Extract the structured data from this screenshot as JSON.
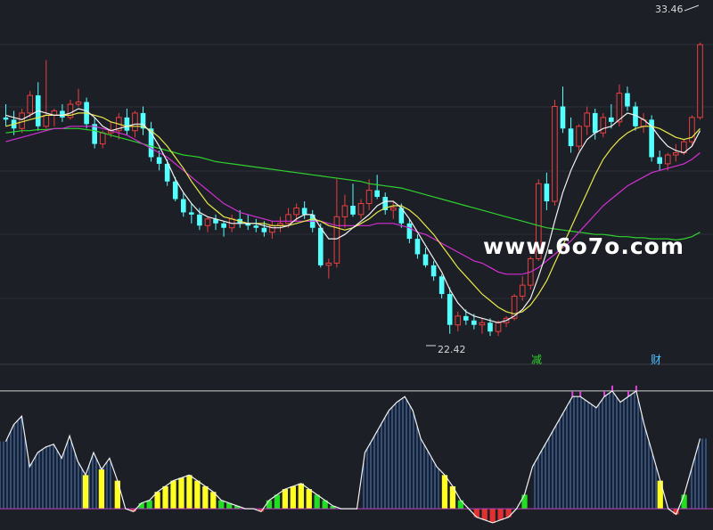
{
  "chart_data": [
    {
      "type": "candlestick",
      "panel": "main",
      "price_range": [
        19.5,
        35.0
      ],
      "annotations": {
        "high_label": "33.46",
        "low_label": "22.42",
        "event_markers": [
          "减",
          "财"
        ],
        "watermark": "www.6o7o.com"
      },
      "candles": [
        [
          30.0,
          30.6,
          29.6,
          29.9
        ],
        [
          29.9,
          30.3,
          29.2,
          29.5
        ],
        [
          29.5,
          30.4,
          29.3,
          30.2
        ],
        [
          30.2,
          31.2,
          30.0,
          31.0
        ],
        [
          31.0,
          31.6,
          29.4,
          29.6
        ],
        [
          29.6,
          32.6,
          29.5,
          30.1
        ],
        [
          30.1,
          30.4,
          29.6,
          30.3
        ],
        [
          30.3,
          30.6,
          29.8,
          30.0
        ],
        [
          30.0,
          30.8,
          29.9,
          30.6
        ],
        [
          30.6,
          31.3,
          30.5,
          30.7
        ],
        [
          30.7,
          30.9,
          29.5,
          29.7
        ],
        [
          29.7,
          30.0,
          28.6,
          28.8
        ],
        [
          28.8,
          29.4,
          28.6,
          29.3
        ],
        [
          29.3,
          29.8,
          29.1,
          29.4
        ],
        [
          29.4,
          30.2,
          29.0,
          30.0
        ],
        [
          30.0,
          30.4,
          29.2,
          29.4
        ],
        [
          29.4,
          30.3,
          29.1,
          30.2
        ],
        [
          30.2,
          30.5,
          29.2,
          29.5
        ],
        [
          29.5,
          29.8,
          28.0,
          28.2
        ],
        [
          28.2,
          28.5,
          27.6,
          27.9
        ],
        [
          27.9,
          28.1,
          26.9,
          27.1
        ],
        [
          27.1,
          27.3,
          26.2,
          26.3
        ],
        [
          26.3,
          26.6,
          25.5,
          25.7
        ],
        [
          25.7,
          26.1,
          25.2,
          25.6
        ],
        [
          25.6,
          25.9,
          24.9,
          25.1
        ],
        [
          25.1,
          25.5,
          24.8,
          25.4
        ],
        [
          25.4,
          25.6,
          24.9,
          25.2
        ],
        [
          25.2,
          25.3,
          24.6,
          25.0
        ],
        [
          25.0,
          25.6,
          24.8,
          25.4
        ],
        [
          25.4,
          25.8,
          25.0,
          25.2
        ],
        [
          25.2,
          25.6,
          24.9,
          25.1
        ],
        [
          25.1,
          25.4,
          24.8,
          25.0
        ],
        [
          25.0,
          25.3,
          24.6,
          24.8
        ],
        [
          24.8,
          25.3,
          24.5,
          25.1
        ],
        [
          25.1,
          25.5,
          24.8,
          25.2
        ],
        [
          25.2,
          25.9,
          25.0,
          25.6
        ],
        [
          25.6,
          26.1,
          25.3,
          25.9
        ],
        [
          25.9,
          26.2,
          25.4,
          25.6
        ],
        [
          25.6,
          25.8,
          24.8,
          25.0
        ],
        [
          25.0,
          25.2,
          23.2,
          23.3
        ],
        [
          23.3,
          23.6,
          22.7,
          23.4
        ],
        [
          23.4,
          27.2,
          23.2,
          25.5
        ],
        [
          25.5,
          26.5,
          25.0,
          26.0
        ],
        [
          26.0,
          27.0,
          25.5,
          25.6
        ],
        [
          25.6,
          26.3,
          25.4,
          26.1
        ],
        [
          26.1,
          27.2,
          25.8,
          26.7
        ],
        [
          26.7,
          27.4,
          26.3,
          26.4
        ],
        [
          26.4,
          26.6,
          25.6,
          25.8
        ],
        [
          25.8,
          26.2,
          25.4,
          25.9
        ],
        [
          25.9,
          26.1,
          25.0,
          25.2
        ],
        [
          25.2,
          25.4,
          24.3,
          24.5
        ],
        [
          24.5,
          24.7,
          23.6,
          23.8
        ],
        [
          23.8,
          24.1,
          23.2,
          23.3
        ],
        [
          23.3,
          23.5,
          22.6,
          22.8
        ],
        [
          22.8,
          22.9,
          21.8,
          22.0
        ],
        [
          22.0,
          22.3,
          20.2,
          20.6
        ],
        [
          20.6,
          21.2,
          20.3,
          21.0
        ],
        [
          21.0,
          21.3,
          20.6,
          20.8
        ],
        [
          20.8,
          21.1,
          20.4,
          20.6
        ],
        [
          20.6,
          20.9,
          20.2,
          20.7
        ],
        [
          20.7,
          20.9,
          20.1,
          20.3
        ],
        [
          20.3,
          20.8,
          20.1,
          20.7
        ],
        [
          20.7,
          21.0,
          20.5,
          20.9
        ],
        [
          20.9,
          22.0,
          20.8,
          21.9
        ],
        [
          21.9,
          22.8,
          21.7,
          22.4
        ],
        [
          22.4,
          23.7,
          22.2,
          23.6
        ],
        [
          23.6,
          27.2,
          23.5,
          27.0
        ],
        [
          27.0,
          27.5,
          25.8,
          26.2
        ],
        [
          26.2,
          30.8,
          26.0,
          30.5
        ],
        [
          30.5,
          31.4,
          29.3,
          29.5
        ],
        [
          29.5,
          30.0,
          28.4,
          28.7
        ],
        [
          28.7,
          29.7,
          28.5,
          29.6
        ],
        [
          29.6,
          30.5,
          29.2,
          30.2
        ],
        [
          30.2,
          30.4,
          29.0,
          29.3
        ],
        [
          29.3,
          30.2,
          29.1,
          30.0
        ],
        [
          30.0,
          30.6,
          29.5,
          29.8
        ],
        [
          29.8,
          31.5,
          29.6,
          31.1
        ],
        [
          31.1,
          31.4,
          30.3,
          30.5
        ],
        [
          30.5,
          30.7,
          29.4,
          29.6
        ],
        [
          29.6,
          30.2,
          29.3,
          29.9
        ],
        [
          29.9,
          30.1,
          28.0,
          28.2
        ],
        [
          28.2,
          28.5,
          27.6,
          27.9
        ],
        [
          27.9,
          28.4,
          27.6,
          28.3
        ],
        [
          28.3,
          28.8,
          28.0,
          28.4
        ],
        [
          28.4,
          29.0,
          28.3,
          28.9
        ],
        [
          28.9,
          30.1,
          28.7,
          30.0
        ],
        [
          30.0,
          33.4,
          29.9,
          33.3
        ]
      ],
      "ma_fast": [
        30.1,
        30.0,
        29.9,
        30.1,
        30.3,
        30.2,
        30.1,
        30.1,
        30.2,
        30.4,
        30.3,
        30.0,
        29.6,
        29.4,
        29.5,
        29.6,
        29.7,
        29.7,
        29.3,
        28.7,
        28.0,
        27.2,
        26.6,
        26.1,
        25.7,
        25.5,
        25.4,
        25.3,
        25.2,
        25.2,
        25.2,
        25.2,
        25.1,
        25.0,
        25.0,
        25.1,
        25.4,
        25.6,
        25.6,
        25.0,
        24.5,
        24.5,
        24.7,
        25.0,
        25.3,
        25.6,
        26.0,
        26.2,
        26.2,
        25.9,
        25.4,
        24.8,
        24.2,
        23.6,
        23.0,
        22.2,
        21.6,
        21.2,
        21.0,
        20.9,
        20.8,
        20.7,
        20.8,
        21.0,
        21.3,
        21.8,
        22.8,
        23.9,
        25.3,
        26.6,
        27.6,
        28.4,
        29.0,
        29.3,
        29.5,
        29.6,
        29.9,
        30.2,
        30.1,
        29.9,
        29.6,
        29.1,
        28.7,
        28.5,
        28.4,
        28.7,
        29.4
      ],
      "ma_mid": [
        29.6,
        29.7,
        29.8,
        29.9,
        30.0,
        30.1,
        30.1,
        30.1,
        30.1,
        30.2,
        30.2,
        30.1,
        30.0,
        29.8,
        29.7,
        29.6,
        29.6,
        29.6,
        29.4,
        29.1,
        28.7,
        28.2,
        27.7,
        27.1,
        26.6,
        26.1,
        25.8,
        25.5,
        25.4,
        25.3,
        25.2,
        25.2,
        25.2,
        25.1,
        25.1,
        25.1,
        25.2,
        25.3,
        25.4,
        25.3,
        25.1,
        25.0,
        24.9,
        25.0,
        25.2,
        25.4,
        25.7,
        25.9,
        26.0,
        26.0,
        25.8,
        25.5,
        25.1,
        24.7,
        24.2,
        23.7,
        23.2,
        22.8,
        22.4,
        22.0,
        21.7,
        21.4,
        21.2,
        21.1,
        21.2,
        21.5,
        22.0,
        22.6,
        23.4,
        24.2,
        25.0,
        25.8,
        26.6,
        27.4,
        28.1,
        28.6,
        29.0,
        29.3,
        29.5,
        29.6,
        29.6,
        29.5,
        29.3,
        29.1,
        29.0,
        29.1,
        29.5
      ],
      "ma_slow": [
        28.9,
        29.0,
        29.1,
        29.2,
        29.3,
        29.4,
        29.5,
        29.5,
        29.6,
        29.6,
        29.6,
        29.6,
        29.5,
        29.4,
        29.3,
        29.2,
        29.0,
        28.8,
        28.6,
        28.4,
        28.2,
        27.9,
        27.6,
        27.3,
        27.0,
        26.7,
        26.4,
        26.1,
        25.9,
        25.7,
        25.6,
        25.5,
        25.4,
        25.3,
        25.3,
        25.3,
        25.3,
        25.3,
        25.3,
        25.3,
        25.2,
        25.1,
        25.1,
        25.1,
        25.1,
        25.1,
        25.2,
        25.2,
        25.2,
        25.1,
        25.0,
        24.8,
        24.7,
        24.5,
        24.3,
        24.1,
        23.9,
        23.7,
        23.5,
        23.4,
        23.2,
        23.0,
        22.9,
        22.9,
        22.9,
        23.0,
        23.2,
        23.5,
        23.8,
        24.1,
        24.4,
        24.8,
        25.2,
        25.6,
        26.0,
        26.3,
        26.6,
        26.9,
        27.1,
        27.3,
        27.5,
        27.6,
        27.7,
        27.8,
        27.9,
        28.1,
        28.4
      ],
      "ma_long": [
        29.3,
        29.35,
        29.4,
        29.4,
        29.45,
        29.45,
        29.5,
        29.5,
        29.5,
        29.5,
        29.45,
        29.4,
        29.3,
        29.2,
        29.1,
        29.0,
        28.9,
        28.8,
        28.7,
        28.6,
        28.5,
        28.4,
        28.3,
        28.25,
        28.2,
        28.1,
        28.0,
        27.95,
        27.9,
        27.85,
        27.8,
        27.75,
        27.7,
        27.65,
        27.6,
        27.55,
        27.5,
        27.45,
        27.4,
        27.35,
        27.3,
        27.25,
        27.2,
        27.15,
        27.1,
        27.0,
        26.95,
        26.9,
        26.85,
        26.8,
        26.7,
        26.6,
        26.5,
        26.4,
        26.3,
        26.2,
        26.1,
        26.0,
        25.9,
        25.8,
        25.7,
        25.6,
        25.5,
        25.4,
        25.3,
        25.2,
        25.1,
        25.0,
        24.95,
        24.9,
        24.85,
        24.8,
        24.75,
        24.7,
        24.7,
        24.65,
        24.6,
        24.6,
        24.55,
        24.55,
        24.5,
        24.5,
        24.5,
        24.45,
        24.5,
        24.6,
        24.8
      ]
    },
    {
      "type": "bar",
      "panel": "indicator",
      "value_range": [
        -6,
        48
      ],
      "reference_level": 42,
      "line": [
        24,
        30,
        33,
        15,
        20,
        22,
        23,
        18,
        26,
        17,
        12,
        20,
        14,
        18,
        10,
        0,
        -1,
        2,
        3,
        6,
        8,
        10,
        11,
        12,
        10,
        8,
        6,
        3,
        2,
        1,
        0,
        0,
        -1,
        3,
        5,
        7,
        8,
        9,
        7,
        5,
        3,
        1,
        0,
        0,
        0,
        20,
        25,
        30,
        35,
        38,
        40,
        35,
        25,
        20,
        15,
        12,
        8,
        3,
        0,
        -3,
        -4,
        -5,
        -4,
        -3,
        0,
        5,
        15,
        20,
        25,
        30,
        35,
        40,
        40,
        38,
        36,
        40,
        42,
        38,
        40,
        42,
        30,
        20,
        10,
        0,
        -2,
        5,
        15,
        25
      ],
      "hist": [
        24,
        30,
        33,
        15,
        20,
        22,
        23,
        18,
        26,
        17,
        12,
        20,
        14,
        18,
        10,
        0,
        -1,
        2,
        3,
        6,
        8,
        10,
        11,
        12,
        10,
        8,
        6,
        3,
        2,
        1,
        0,
        0,
        -1,
        3,
        5,
        7,
        8,
        9,
        7,
        5,
        3,
        1,
        0,
        0,
        0,
        20,
        25,
        30,
        35,
        38,
        40,
        35,
        25,
        20,
        15,
        12,
        8,
        3,
        0,
        -3,
        -4,
        -5,
        -4,
        -3,
        0,
        5,
        15,
        20,
        25,
        30,
        35,
        40,
        40,
        38,
        36,
        40,
        42,
        38,
        40,
        42,
        30,
        20,
        10,
        0,
        -2,
        5,
        15,
        25
      ]
    }
  ]
}
